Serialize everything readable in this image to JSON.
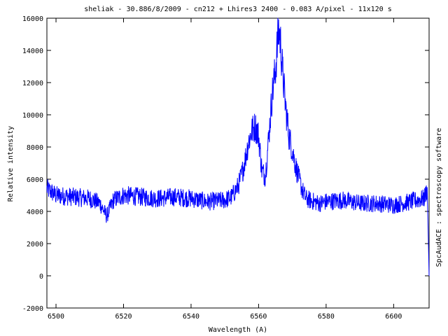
{
  "chart_data": {
    "type": "line",
    "title": "sheliak - 30.886/8/2009 - cn212 + Lhires3 2400 - 0.083 A/pixel - 11x120 s",
    "xlabel": "Wavelength (A)",
    "ylabel": "Relative intensity",
    "side_label": "SpcAudACE : spectroscopy software",
    "xlim": [
      6497.3,
      6610.5
    ],
    "ylim": [
      -2000,
      16000
    ],
    "x_ticks": [
      "6500",
      "6520",
      "6540",
      "6560",
      "6580",
      "6600"
    ],
    "y_ticks": [
      "-2000",
      "0",
      "2000",
      "4000",
      "6000",
      "8000",
      "10000",
      "12000",
      "14000",
      "16000"
    ],
    "grid": false,
    "line_color": "#0000ff",
    "series": [
      {
        "x": [
          6497.3,
          6500,
          6505,
          6510,
          6513,
          6515,
          6517,
          6520,
          6525,
          6530,
          6535,
          6540,
          6545,
          6550,
          6552,
          6554,
          6555,
          6556,
          6557,
          6558,
          6559,
          6560,
          6561,
          6562,
          6563,
          6564,
          6565,
          6565.5,
          6566,
          6566.5,
          6567,
          6568,
          6569,
          6570,
          6571,
          6572,
          6573,
          6574,
          6575,
          6578,
          6580,
          6585,
          6590,
          6595,
          6600,
          6605,
          6609,
          6610,
          6610.3,
          6610.5
        ],
        "y": [
          5400,
          5000,
          4900,
          4800,
          4500,
          3700,
          4700,
          5000,
          4900,
          4800,
          4900,
          4800,
          4600,
          4700,
          4900,
          5600,
          6300,
          7200,
          8300,
          9000,
          9300,
          8700,
          6500,
          6200,
          8600,
          11200,
          12800,
          14200,
          15300,
          14500,
          13000,
          10500,
          8700,
          7800,
          6800,
          6000,
          5300,
          4800,
          4700,
          4500,
          4600,
          4700,
          4500,
          4500,
          4400,
          4600,
          4800,
          5400,
          2000,
          0
        ]
      }
    ]
  }
}
